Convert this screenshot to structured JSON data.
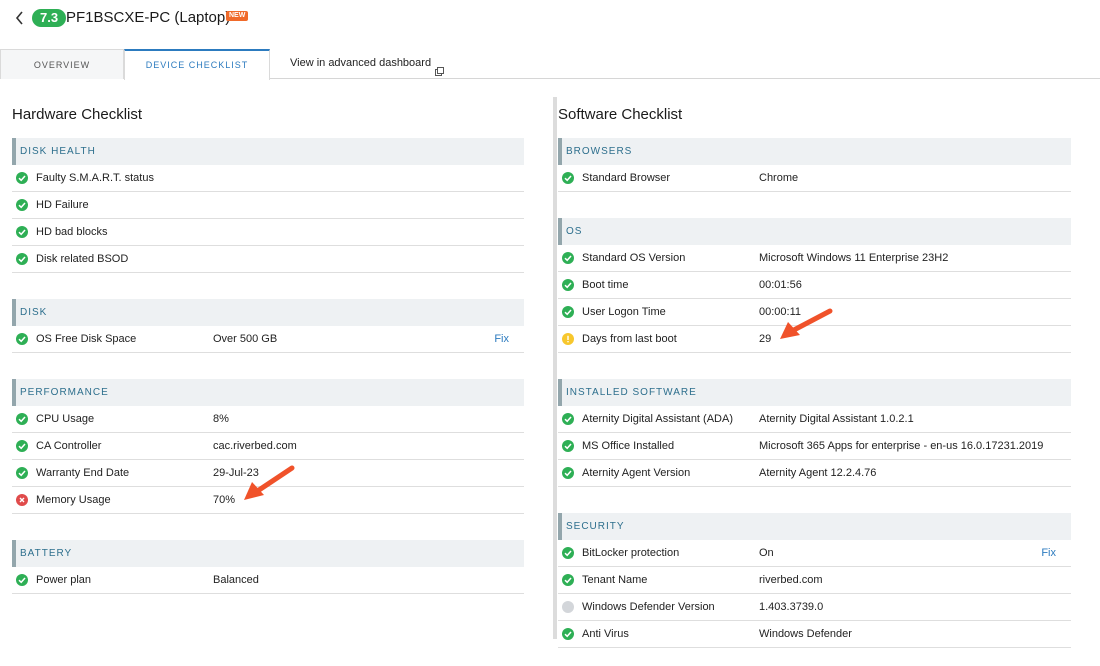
{
  "header": {
    "score": "7.3",
    "device_title": "PF1BSCXE-PC (Laptop)",
    "new_badge": "NEW"
  },
  "tabs": {
    "overview": "OVERVIEW",
    "device_checklist": "DEVICE CHECKLIST",
    "advanced_dashboard": "View in advanced dashboard"
  },
  "hardware": {
    "title": "Hardware Checklist",
    "sections": [
      {
        "header": "DISK HEALTH",
        "rows": [
          {
            "status": "ok",
            "name": "Faulty S.M.A.R.T. status",
            "value": ""
          },
          {
            "status": "ok",
            "name": "HD Failure",
            "value": ""
          },
          {
            "status": "ok",
            "name": "HD bad blocks",
            "value": ""
          },
          {
            "status": "ok",
            "name": "Disk related BSOD",
            "value": ""
          }
        ]
      },
      {
        "header": "DISK",
        "rows": [
          {
            "status": "ok",
            "name": "OS Free Disk Space",
            "value": "Over 500 GB",
            "action": "Fix"
          }
        ]
      },
      {
        "header": "PERFORMANCE",
        "rows": [
          {
            "status": "ok",
            "name": "CPU Usage",
            "value": "8%"
          },
          {
            "status": "ok",
            "name": "CA Controller",
            "value": "cac.riverbed.com"
          },
          {
            "status": "ok",
            "name": "Warranty End Date",
            "value": "29-Jul-23"
          },
          {
            "status": "err",
            "name": "Memory Usage",
            "value": "70%"
          }
        ]
      },
      {
        "header": "BATTERY",
        "rows": [
          {
            "status": "ok",
            "name": "Power plan",
            "value": "Balanced"
          }
        ]
      }
    ]
  },
  "software": {
    "title": "Software Checklist",
    "sections": [
      {
        "header": "BROWSERS",
        "rows": [
          {
            "status": "ok",
            "name": "Standard Browser",
            "value": "Chrome"
          }
        ]
      },
      {
        "header": "OS",
        "rows": [
          {
            "status": "ok",
            "name": "Standard OS Version",
            "value": "Microsoft Windows 11 Enterprise 23H2"
          },
          {
            "status": "ok",
            "name": "Boot time",
            "value": "00:01:56"
          },
          {
            "status": "ok",
            "name": "User Logon Time",
            "value": "00:00:11"
          },
          {
            "status": "warn",
            "name": "Days from last boot",
            "value": "29"
          }
        ]
      },
      {
        "header": "INSTALLED SOFTWARE",
        "rows": [
          {
            "status": "ok",
            "name": "Aternity Digital Assistant (ADA)",
            "value": "Aternity Digital Assistant 1.0.2.1"
          },
          {
            "status": "ok",
            "name": "MS Office Installed",
            "value": "Microsoft 365 Apps for enterprise - en-us 16.0.17231.2019"
          },
          {
            "status": "ok",
            "name": "Aternity Agent Version",
            "value": "Aternity Agent 12.2.4.76"
          }
        ]
      },
      {
        "header": "SECURITY",
        "rows": [
          {
            "status": "ok",
            "name": "BitLocker protection",
            "value": "On",
            "action": "Fix"
          },
          {
            "status": "ok",
            "name": "Tenant Name",
            "value": "riverbed.com"
          },
          {
            "status": "unknown",
            "name": "Windows Defender Version",
            "value": "1.403.3739.0"
          },
          {
            "status": "ok",
            "name": "Anti Virus",
            "value": "Windows Defender"
          }
        ]
      }
    ]
  },
  "colors": {
    "ok": "#2eaf55",
    "error": "#e04b4b",
    "warning": "#f7c72d",
    "unknown": "#d3d6da",
    "accent": "#2c7bbf",
    "annotation_arrow": "#f0522a"
  }
}
